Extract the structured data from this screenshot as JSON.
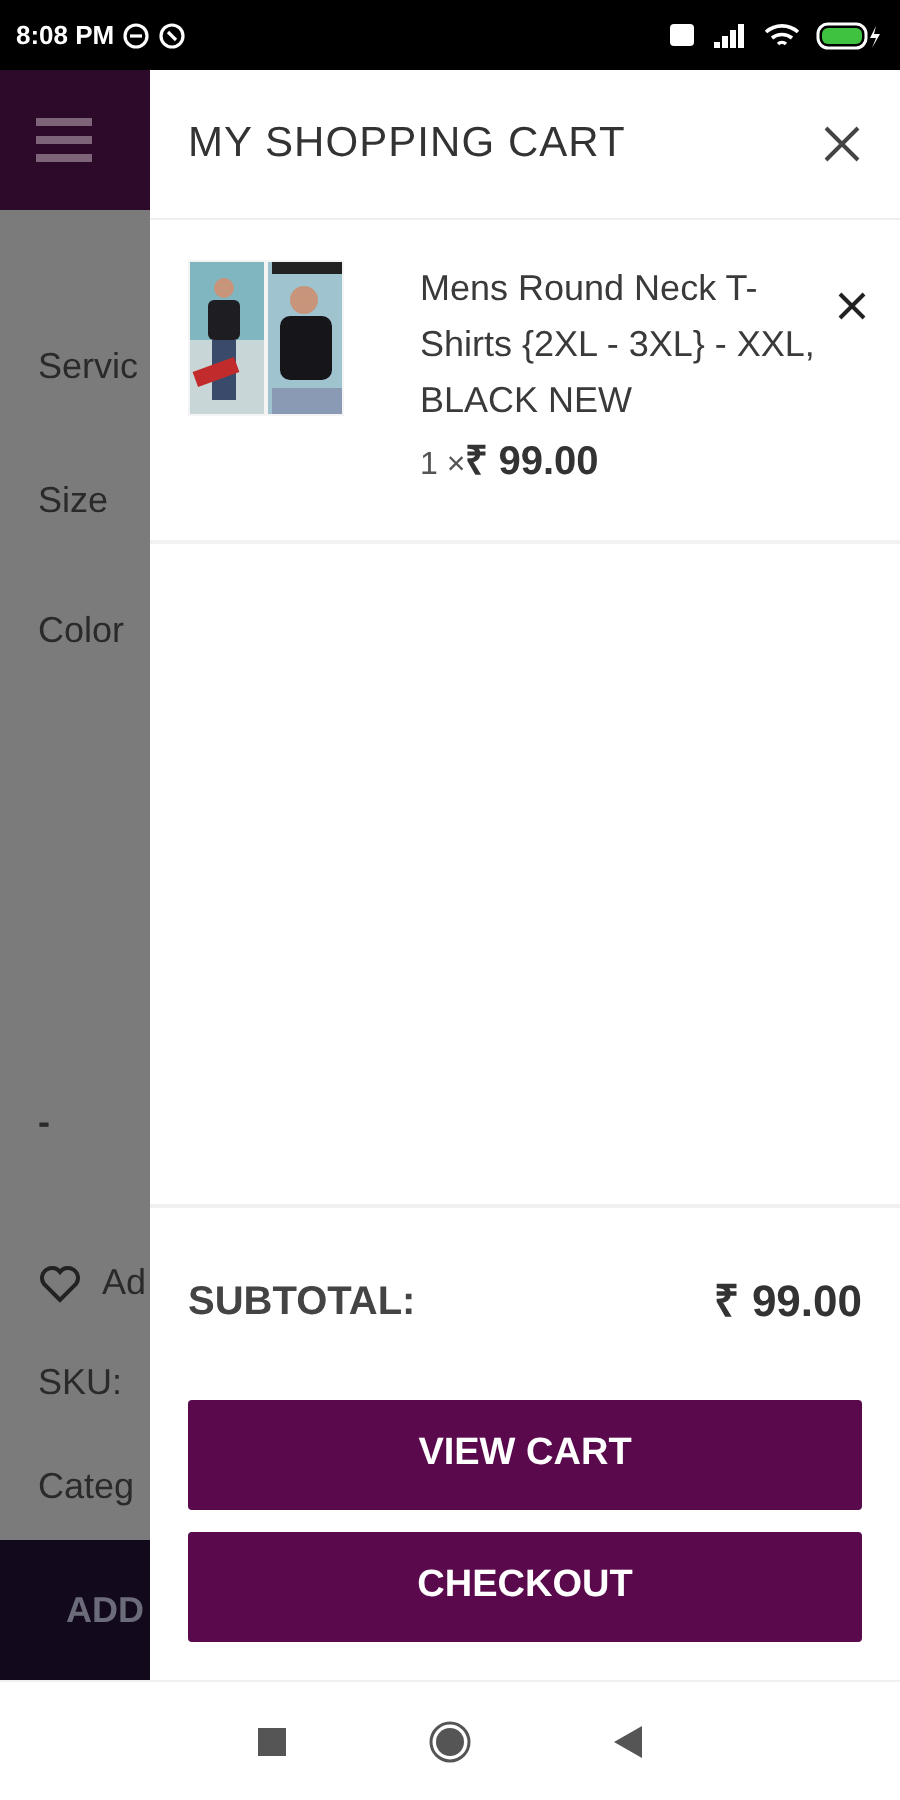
{
  "status_bar": {
    "time": "8:08 PM"
  },
  "background_page": {
    "labels": [
      "Servic",
      "Size",
      "Color",
      "-",
      "Ad",
      "SKU:",
      "Categ"
    ],
    "add_button": "ADD"
  },
  "cart": {
    "title": "MY SHOPPING CART",
    "items": [
      {
        "kind": "picture",
        "name": "Mens Round Neck T-Shirts {2XL - 3XL} - XXL, BLACK NEW",
        "quantity": "1 ×",
        "price": "₹ 99.00"
      }
    ],
    "subtotal_label": "SUBTOTAL:",
    "subtotal": "₹ 99.00",
    "buttons": [
      "VIEW CART",
      "CHECKOUT"
    ]
  }
}
